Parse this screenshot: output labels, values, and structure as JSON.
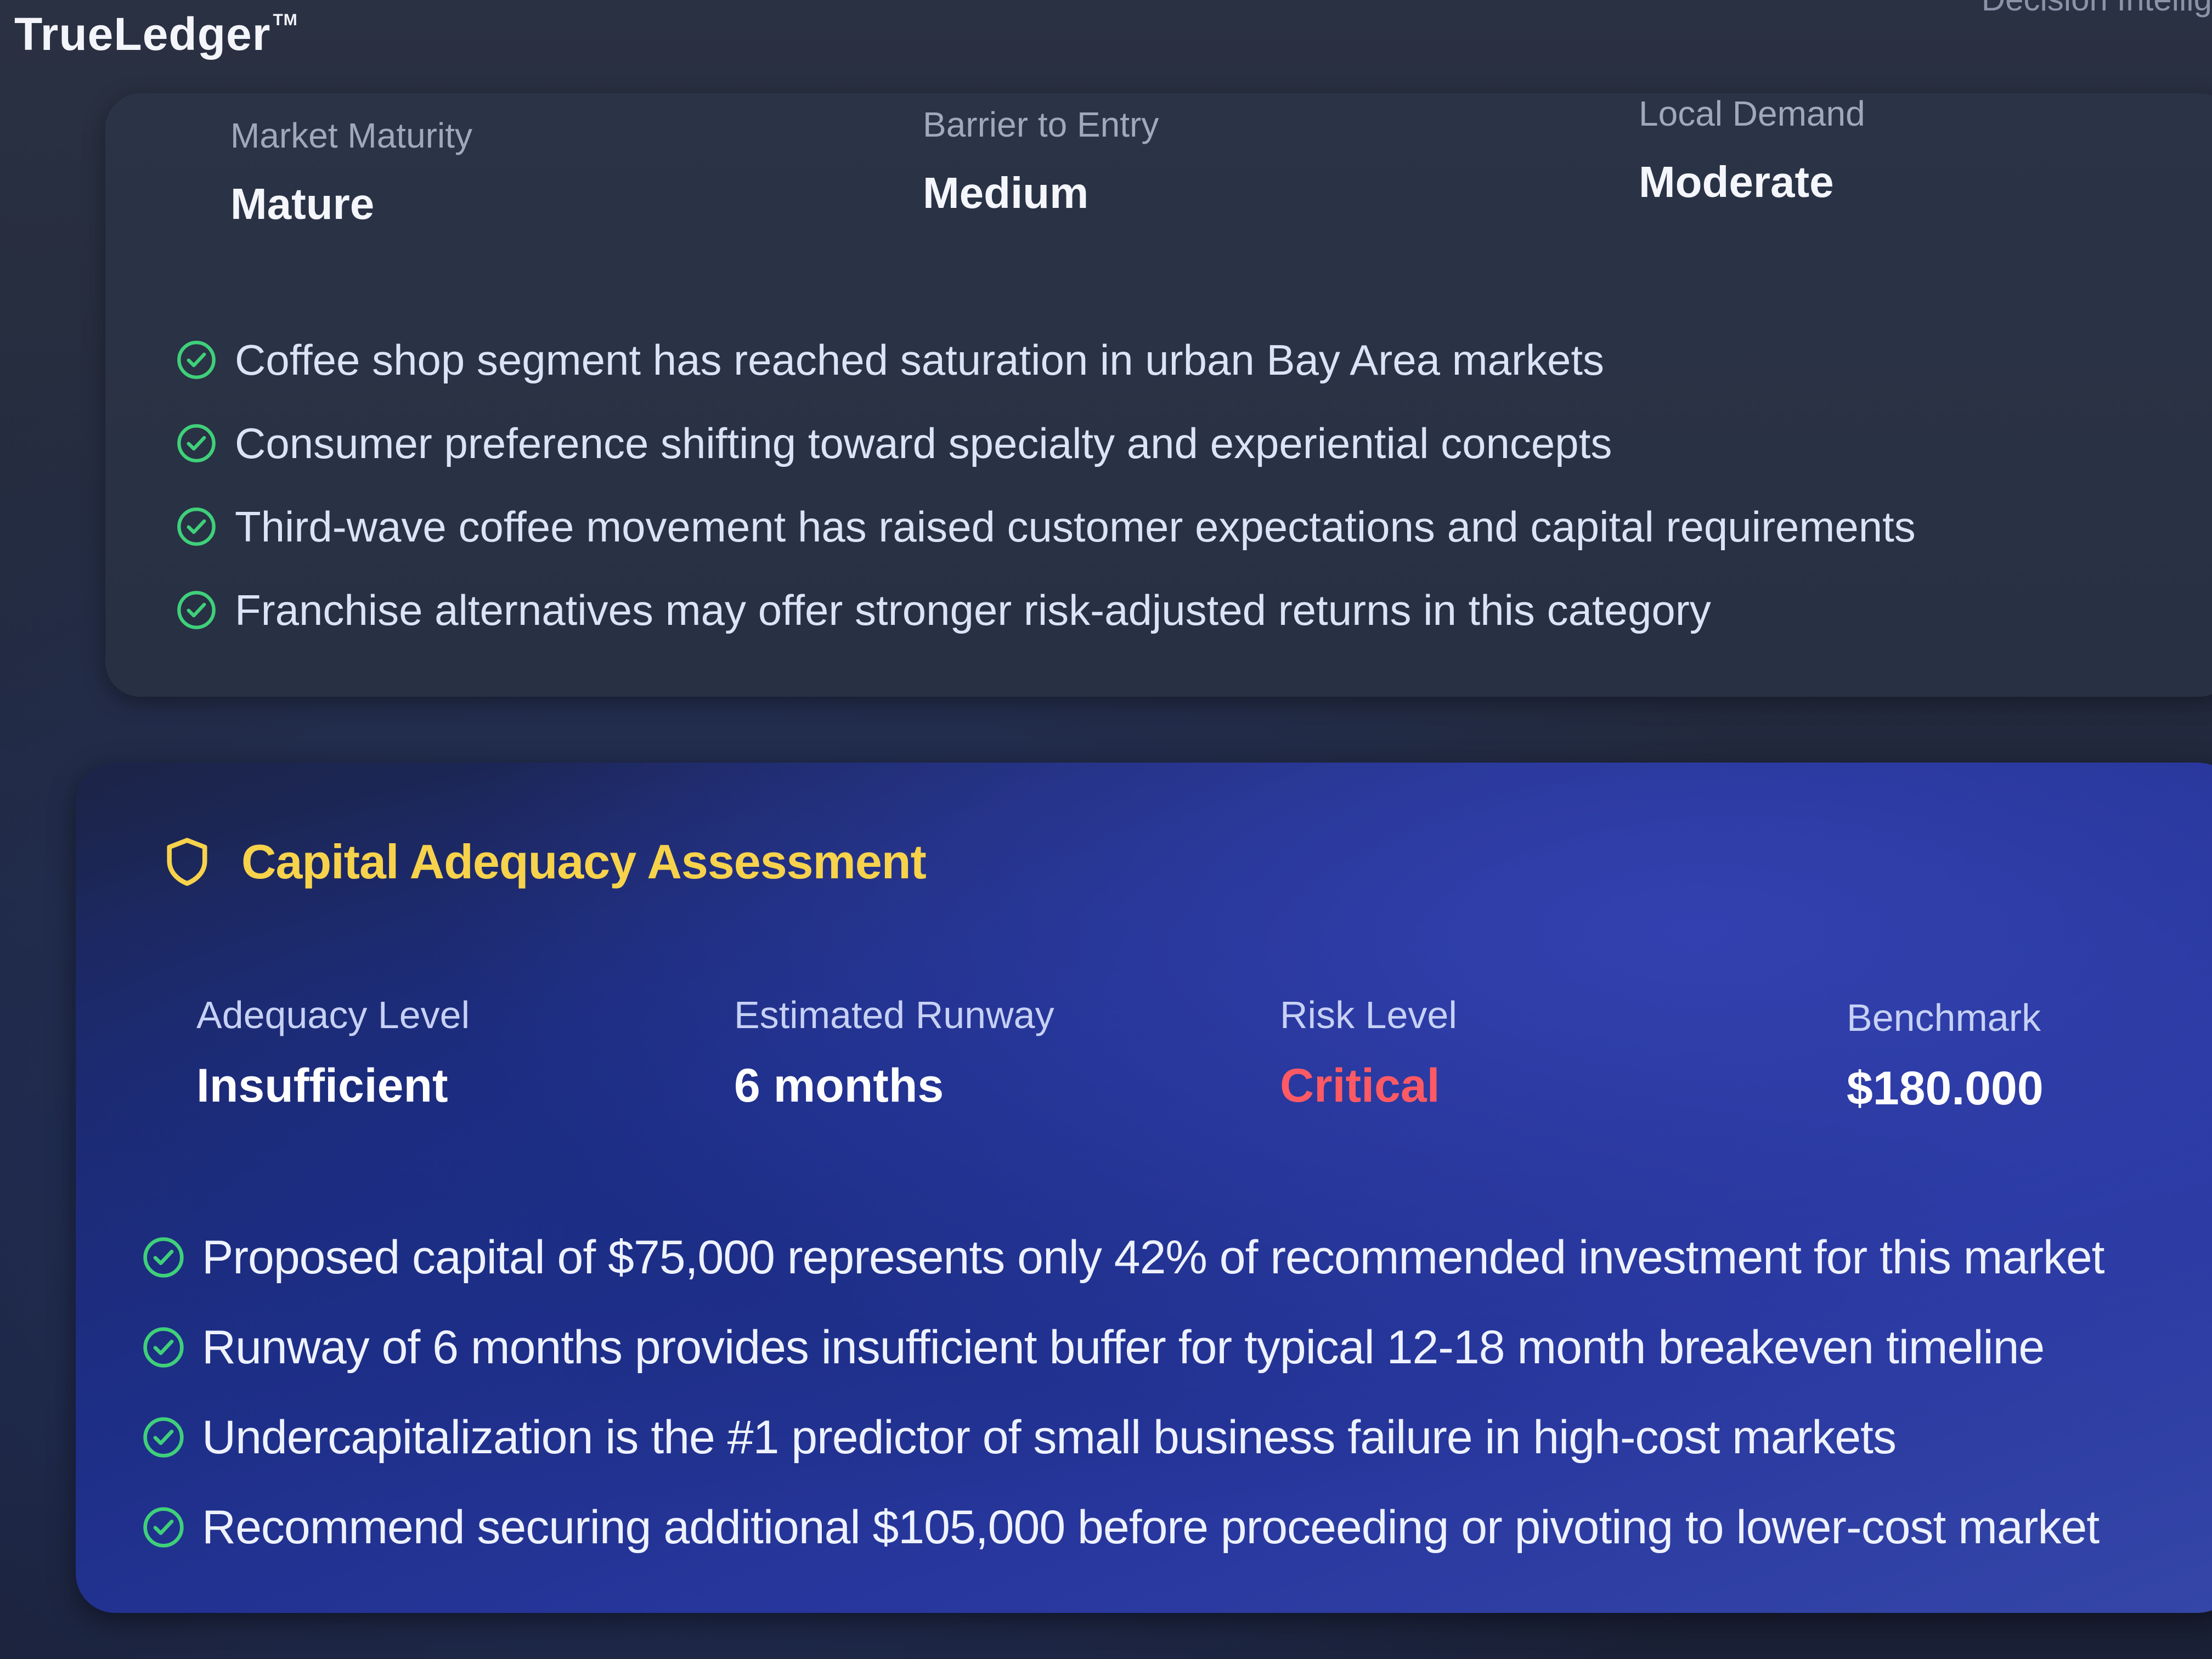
{
  "app": {
    "brand": "TrueLedger",
    "trademark": "TM",
    "top_right_text": "Decision Intellig"
  },
  "market": {
    "metrics": [
      {
        "label": "Market Maturity",
        "value": "Mature"
      },
      {
        "label": "Barrier to Entry",
        "value": "Medium"
      },
      {
        "label": "Local Demand",
        "value": "Moderate"
      }
    ],
    "bullets": [
      "Coffee shop segment has reached saturation in urban Bay Area markets",
      "Consumer preference shifting toward specialty and experiential concepts",
      "Third-wave coffee movement has raised customer expectations and capital requirements",
      "Franchise alternatives may offer stronger risk-adjusted returns in this category"
    ]
  },
  "capital": {
    "title": "Capital Adequacy Assessment",
    "icon": "shield-icon",
    "metrics": [
      {
        "label": "Adequacy Level",
        "value": "Insufficient"
      },
      {
        "label": "Estimated Runway",
        "value": "6 months"
      },
      {
        "label": "Risk Level",
        "value": "Critical"
      },
      {
        "label": "Benchmark",
        "value": "$180.000"
      }
    ],
    "bullets": [
      "Proposed capital of $75,000 represents only 42% of recommended investment for this market",
      "Runway of 6 months provides insufficient buffer for typical 12-18 month breakeven timeline",
      "Undercapitalization is the #1 predictor of small business failure in high-cost markets",
      "Recommend securing additional $105,000 before proceeding or pivoting to lower-cost market"
    ]
  },
  "colors": {
    "accent_yellow": "#f7d24b",
    "critical_red": "#ff5a64",
    "check_green": "#3fd07a",
    "card_blue": "#1d2e86"
  }
}
